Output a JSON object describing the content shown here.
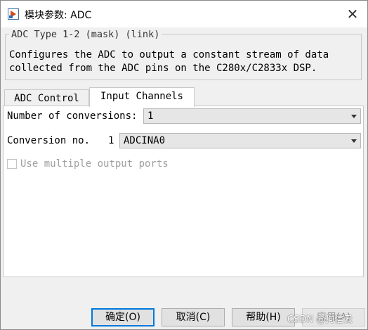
{
  "window": {
    "title": "模块参数: ADC",
    "close_glyph": "✕"
  },
  "group": {
    "legend": "ADC Type 1-2 (mask) (link)",
    "description_line1": "Configures the ADC to output a constant stream of data",
    "description_line2": "collected from the ADC pins on the C280x/C2833x DSP."
  },
  "tabs": [
    {
      "label": "ADC Control",
      "active": false
    },
    {
      "label": "Input Channels",
      "active": true
    }
  ],
  "input_channels": {
    "num_conversions_label": "Number of conversions:",
    "num_conversions_value": "1",
    "conversion_no_label": "Conversion no.",
    "conversion_no_index": "1",
    "conversion_channel_value": "ADCINA0",
    "multiple_ports_label": "Use multiple output ports",
    "multiple_ports_checked": false
  },
  "buttons": {
    "ok": "确定(O)",
    "cancel": "取消(C)",
    "help": "帮助(H)",
    "apply": "应用(A)"
  },
  "watermark": "CSDN @狗信云"
}
